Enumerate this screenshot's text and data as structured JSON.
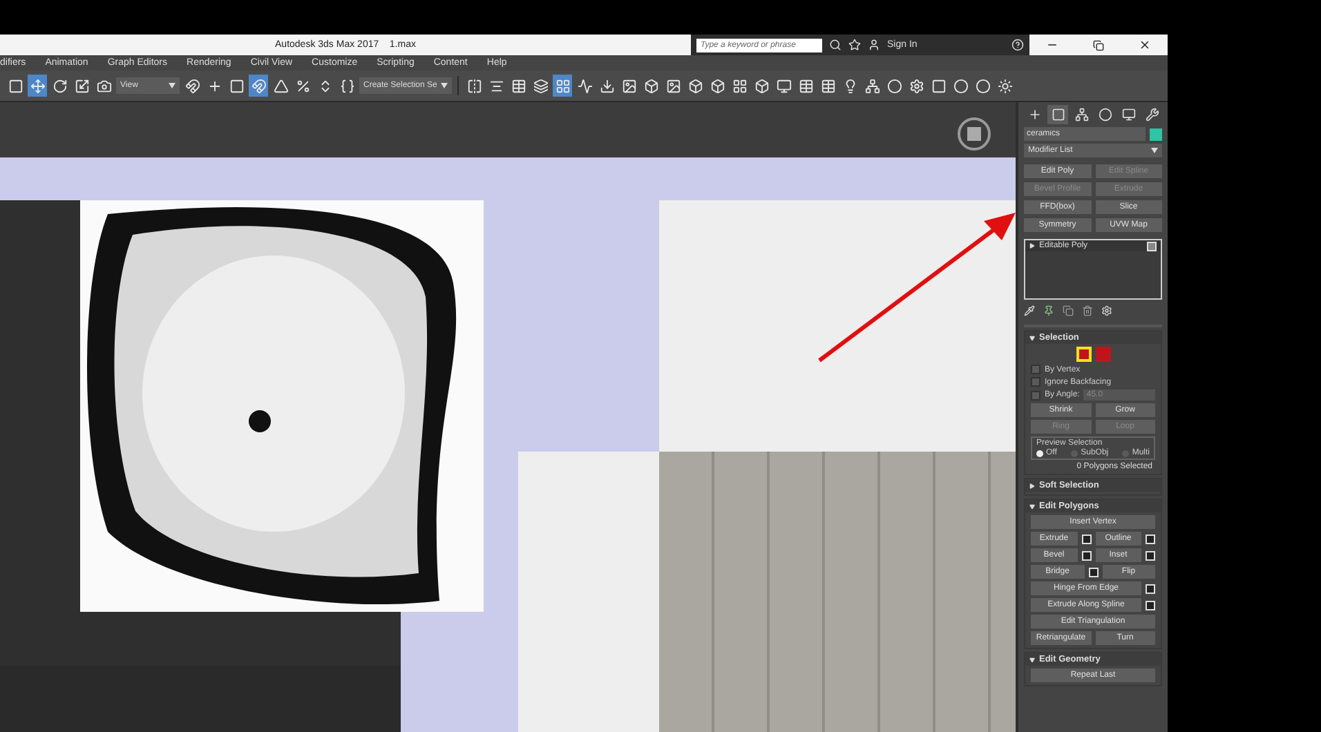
{
  "window": {
    "title": "Autodesk 3ds Max 2017    1.max"
  },
  "search": {
    "placeholder": "Type a keyword or phrase"
  },
  "sign_in": "Sign In",
  "menu": [
    "difiers",
    "Animation",
    "Graph Editors",
    "Rendering",
    "Civil View",
    "Customize",
    "Scripting",
    "Content",
    "Help"
  ],
  "toolbar": {
    "tools_a": [
      {
        "selected": false
      },
      {
        "selected": true
      },
      {
        "selected": false
      },
      {
        "selected": false
      },
      {
        "selected": false
      }
    ],
    "view_dropdown": "View",
    "tools_b": [
      {
        "selected": false
      },
      {
        "selected": false
      },
      {
        "selected": false
      },
      {
        "selected": true
      },
      {
        "selected": false
      },
      {
        "selected": false
      },
      {
        "selected": false
      },
      {
        "selected": false
      }
    ],
    "selection_set_dropdown": "Create Selection Se",
    "tools_c": [
      {
        "selected": false
      },
      {
        "selected": false
      },
      {
        "selected": false
      },
      {
        "selected": false
      },
      {
        "selected": true
      },
      {
        "selected": false
      },
      {
        "selected": false
      },
      {
        "selected": false
      },
      {
        "selected": false
      },
      {
        "selected": false
      },
      {
        "selected": false
      },
      {
        "selected": false
      },
      {
        "selected": false
      },
      {
        "selected": false
      },
      {
        "selected": false
      },
      {
        "selected": false
      },
      {
        "selected": false
      },
      {
        "selected": false
      },
      {
        "selected": false
      },
      {
        "selected": false
      },
      {
        "selected": false
      },
      {
        "selected": false
      },
      {
        "selected": false
      },
      {
        "selected": false
      },
      {
        "selected": false
      }
    ]
  },
  "command_panel": {
    "tabs": [
      {
        "selected": false
      },
      {
        "selected": true
      },
      {
        "selected": false
      },
      {
        "selected": false
      },
      {
        "selected": false
      },
      {
        "selected": false
      }
    ],
    "object_name": "ceramics",
    "modifier_list": "Modifier List",
    "modifier_buttons": [
      {
        "label": "Edit Poly",
        "disabled": false
      },
      {
        "label": "Edit Spline",
        "disabled": true
      },
      {
        "label": "Bevel Profile",
        "disabled": true
      },
      {
        "label": "Extrude",
        "disabled": true
      },
      {
        "label": "FFD(box)",
        "disabled": false
      },
      {
        "label": "Slice",
        "disabled": false
      },
      {
        "label": "Symmetry",
        "disabled": false
      },
      {
        "label": "UVW Map",
        "disabled": false
      }
    ],
    "stack": [
      {
        "label": "Editable Poly",
        "expanded": false
      }
    ],
    "selection": {
      "title": "Selection",
      "expanded": true,
      "subobject_levels": [
        {
          "selected": true
        },
        {
          "selected": false
        }
      ],
      "checkboxes": [
        {
          "label": "By Vertex",
          "checked": false
        },
        {
          "label": "Ignore Backfacing",
          "checked": false
        },
        {
          "label": "By Angle:",
          "checked": false,
          "value": "45.0"
        }
      ],
      "buttons": [
        {
          "label": "Shrink",
          "disabled": false
        },
        {
          "label": "Grow",
          "disabled": false
        },
        {
          "label": "Ring",
          "disabled": true
        },
        {
          "label": "Loop",
          "disabled": true
        }
      ],
      "preview_title": "Preview Selection",
      "preview_options": [
        {
          "label": "Off",
          "selected": true
        },
        {
          "label": "SubObj",
          "selected": false
        },
        {
          "label": "Multi",
          "selected": false
        }
      ],
      "status": "0 Polygons Selected"
    },
    "soft_selection": {
      "title": "Soft Selection",
      "expanded": false
    },
    "edit_polygons": {
      "title": "Edit Polygons",
      "expanded": true,
      "rows": [
        [
          {
            "label": "Insert Vertex",
            "settings": false
          }
        ],
        [
          {
            "label": "Extrude",
            "settings": true
          },
          {
            "label": "Outline",
            "settings": true
          }
        ],
        [
          {
            "label": "Bevel",
            "settings": true
          },
          {
            "label": "Inset",
            "settings": true
          }
        ],
        [
          {
            "label": "Bridge",
            "settings": true
          },
          {
            "label": "Flip",
            "settings": false
          }
        ],
        [
          {
            "label": "Hinge From Edge",
            "settings": true
          }
        ],
        [
          {
            "label": "Extrude Along Spline",
            "settings": true
          }
        ],
        [
          {
            "label": "Edit Triangulation",
            "settings": false
          }
        ],
        [
          {
            "label": "Retriangulate",
            "settings": false
          },
          {
            "label": "Turn",
            "settings": false
          }
        ]
      ]
    },
    "edit_geometry": {
      "title": "Edit Geometry",
      "expanded": true,
      "buttons": [
        "Repeat Last"
      ]
    }
  }
}
